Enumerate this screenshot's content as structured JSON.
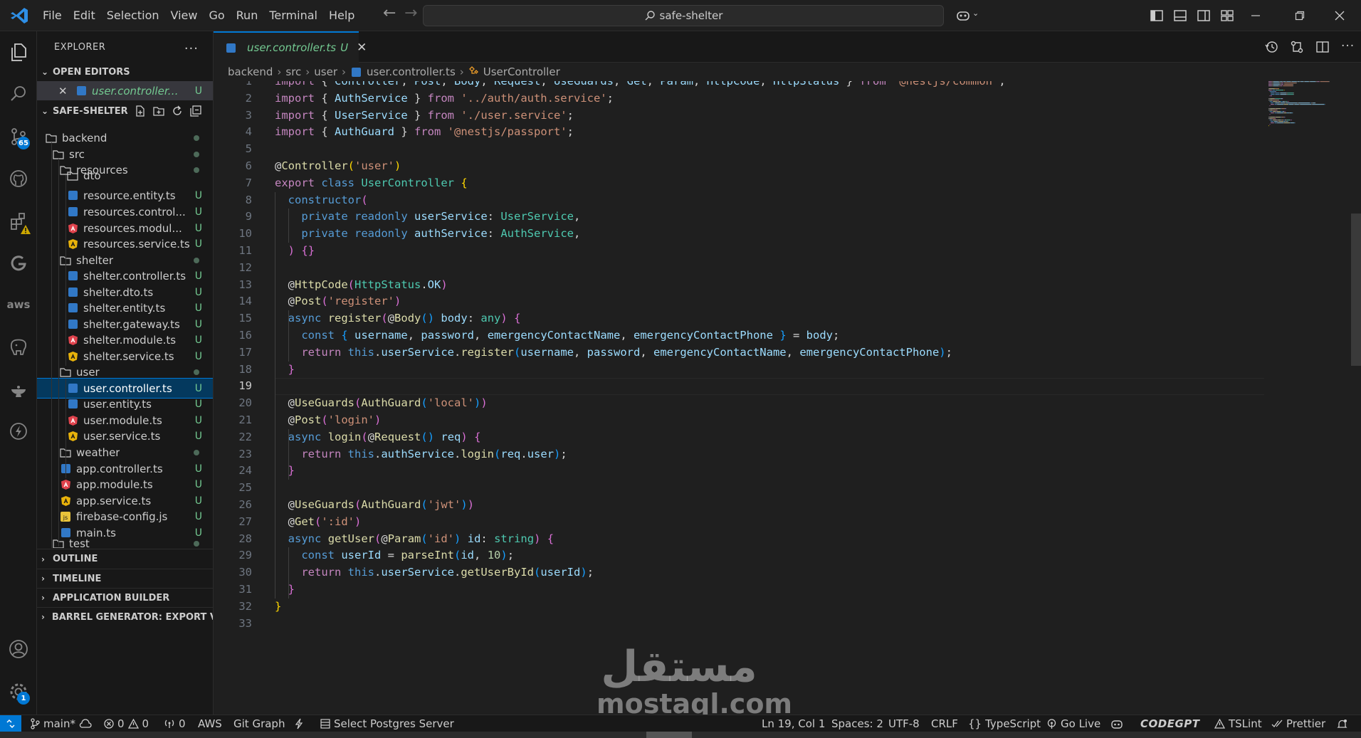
{
  "titlebar": {
    "menu": [
      "File",
      "Edit",
      "Selection",
      "View",
      "Go",
      "Run",
      "Terminal",
      "Help"
    ],
    "search_text": "safe-shelter"
  },
  "activity": {
    "source_control_badge": "65",
    "settings_badge": "1",
    "aws_label": "aws"
  },
  "sidebar": {
    "title": "EXPLORER",
    "more": "···",
    "open_editors_title": "OPEN EDITORS",
    "open_editor": {
      "name": "user.controller.ts...",
      "status": "U"
    },
    "project_title": "SAFE-SHELTER",
    "tree": [
      {
        "label": "backend",
        "kind": "folder",
        "level": 0,
        "status": "dot"
      },
      {
        "label": "src",
        "kind": "folder",
        "level": 1,
        "status": "dot"
      },
      {
        "label": "resources",
        "kind": "folder",
        "level": 2,
        "status": "dot"
      },
      {
        "label": "dto",
        "kind": "folder-partial",
        "level": 3,
        "status": ""
      },
      {
        "label": "resource.entity.ts",
        "kind": "ts",
        "level": 3,
        "status": "U"
      },
      {
        "label": "resources.control...",
        "kind": "ts",
        "level": 3,
        "status": "U"
      },
      {
        "label": "resources.modul...",
        "kind": "angular",
        "level": 3,
        "status": "U"
      },
      {
        "label": "resources.service.ts",
        "kind": "angular-yellow",
        "level": 3,
        "status": "U"
      },
      {
        "label": "shelter",
        "kind": "folder",
        "level": 2,
        "status": "dot"
      },
      {
        "label": "shelter.controller.ts",
        "kind": "ts",
        "level": 3,
        "status": "U"
      },
      {
        "label": "shelter.dto.ts",
        "kind": "ts",
        "level": 3,
        "status": "U"
      },
      {
        "label": "shelter.entity.ts",
        "kind": "ts",
        "level": 3,
        "status": "U"
      },
      {
        "label": "shelter.gateway.ts",
        "kind": "ts",
        "level": 3,
        "status": "U"
      },
      {
        "label": "shelter.module.ts",
        "kind": "angular",
        "level": 3,
        "status": "U"
      },
      {
        "label": "shelter.service.ts",
        "kind": "angular-yellow",
        "level": 3,
        "status": "U"
      },
      {
        "label": "user",
        "kind": "folder",
        "level": 2,
        "status": "dot"
      },
      {
        "label": "user.controller.ts",
        "kind": "ts",
        "level": 3,
        "status": "U",
        "selected": true
      },
      {
        "label": "user.entity.ts",
        "kind": "ts",
        "level": 3,
        "status": "U"
      },
      {
        "label": "user.module.ts",
        "kind": "angular",
        "level": 3,
        "status": "U"
      },
      {
        "label": "user.service.ts",
        "kind": "angular-yellow",
        "level": 3,
        "status": "U"
      },
      {
        "label": "weather",
        "kind": "folder",
        "level": 2,
        "status": "dot"
      },
      {
        "label": "app.controller.ts",
        "kind": "ts",
        "level": 2,
        "status": "U"
      },
      {
        "label": "app.module.ts",
        "kind": "angular",
        "level": 2,
        "status": "U"
      },
      {
        "label": "app.service.ts",
        "kind": "angular-yellow",
        "level": 2,
        "status": "U"
      },
      {
        "label": "firebase-config.js",
        "kind": "js",
        "level": 2,
        "status": "U"
      },
      {
        "label": "main.ts",
        "kind": "ts",
        "level": 2,
        "status": "U"
      },
      {
        "label": "test",
        "kind": "folder-partial",
        "level": 1,
        "status": "dot"
      }
    ],
    "bottom_sections": [
      "OUTLINE",
      "TIMELINE",
      "APPLICATION BUILDER",
      "BARREL GENERATOR: EXPORT V..."
    ]
  },
  "tab": {
    "name": "user.controller.ts",
    "status": "U",
    "close": "✕"
  },
  "breadcrumbs": [
    "backend",
    "src",
    "user",
    "user.controller.ts",
    "UserController"
  ],
  "editor": {
    "current_line": 19,
    "lines": [
      [
        [
          "import",
          "t-ctl"
        ],
        [
          " { ",
          "t-p"
        ],
        [
          "Controller",
          "t-var"
        ],
        [
          ", ",
          "t-p"
        ],
        [
          "Post",
          "t-var"
        ],
        [
          ", ",
          "t-p"
        ],
        [
          "Body",
          "t-var"
        ],
        [
          ", ",
          "t-p"
        ],
        [
          "Request",
          "t-var"
        ],
        [
          ", ",
          "t-p"
        ],
        [
          "UseGuards",
          "t-var"
        ],
        [
          ", ",
          "t-p"
        ],
        [
          "Get",
          "t-var"
        ],
        [
          ", ",
          "t-p"
        ],
        [
          "Param",
          "t-var"
        ],
        [
          ", ",
          "t-p"
        ],
        [
          "HttpCode",
          "t-var"
        ],
        [
          ", ",
          "t-p"
        ],
        [
          "HttpStatus",
          "t-var"
        ],
        [
          " } ",
          "t-p"
        ],
        [
          "from",
          "t-ctl"
        ],
        [
          " ",
          "t-p"
        ],
        [
          "'@nestjs/common'",
          "t-str"
        ],
        [
          ";",
          "t-p"
        ]
      ],
      [
        [
          "import",
          "t-ctl"
        ],
        [
          " { ",
          "t-p"
        ],
        [
          "AuthService",
          "t-var"
        ],
        [
          " } ",
          "t-p"
        ],
        [
          "from",
          "t-ctl"
        ],
        [
          " ",
          "t-p"
        ],
        [
          "'../auth/auth.service'",
          "t-str"
        ],
        [
          ";",
          "t-p"
        ]
      ],
      [
        [
          "import",
          "t-ctl"
        ],
        [
          " { ",
          "t-p"
        ],
        [
          "UserService",
          "t-var"
        ],
        [
          " } ",
          "t-p"
        ],
        [
          "from",
          "t-ctl"
        ],
        [
          " ",
          "t-p"
        ],
        [
          "'./user.service'",
          "t-str"
        ],
        [
          ";",
          "t-p"
        ]
      ],
      [
        [
          "import",
          "t-ctl"
        ],
        [
          " { ",
          "t-p"
        ],
        [
          "AuthGuard",
          "t-var"
        ],
        [
          " } ",
          "t-p"
        ],
        [
          "from",
          "t-ctl"
        ],
        [
          " ",
          "t-p"
        ],
        [
          "'@nestjs/passport'",
          "t-str"
        ],
        [
          ";",
          "t-p"
        ]
      ],
      [],
      [
        [
          "@",
          "t-p"
        ],
        [
          "Controller",
          "t-fn"
        ],
        [
          "(",
          "t-b1"
        ],
        [
          "'user'",
          "t-str"
        ],
        [
          ")",
          "t-b1"
        ]
      ],
      [
        [
          "export",
          "t-ctl"
        ],
        [
          " ",
          "t-p"
        ],
        [
          "class",
          "t-kw"
        ],
        [
          " ",
          "t-p"
        ],
        [
          "UserController",
          "t-ty"
        ],
        [
          " ",
          "t-p"
        ],
        [
          "{",
          "t-b1"
        ]
      ],
      [
        [
          "  ",
          "t-p"
        ],
        [
          "constructor",
          "t-kw"
        ],
        [
          "(",
          "t-b2"
        ]
      ],
      [
        [
          "    ",
          "t-p"
        ],
        [
          "private",
          "t-kw"
        ],
        [
          " ",
          "t-p"
        ],
        [
          "readonly",
          "t-kw"
        ],
        [
          " ",
          "t-p"
        ],
        [
          "userService",
          "t-var"
        ],
        [
          ": ",
          "t-p"
        ],
        [
          "UserService",
          "t-ty"
        ],
        [
          ",",
          "t-p"
        ]
      ],
      [
        [
          "    ",
          "t-p"
        ],
        [
          "private",
          "t-kw"
        ],
        [
          " ",
          "t-p"
        ],
        [
          "readonly",
          "t-kw"
        ],
        [
          " ",
          "t-p"
        ],
        [
          "authService",
          "t-var"
        ],
        [
          ": ",
          "t-p"
        ],
        [
          "AuthService",
          "t-ty"
        ],
        [
          ",",
          "t-p"
        ]
      ],
      [
        [
          "  ",
          "t-p"
        ],
        [
          ")",
          "t-b2"
        ],
        [
          " ",
          "t-p"
        ],
        [
          "{}",
          "t-b2"
        ]
      ],
      [],
      [
        [
          "  @",
          "t-p"
        ],
        [
          "HttpCode",
          "t-fn"
        ],
        [
          "(",
          "t-b2"
        ],
        [
          "HttpStatus",
          "t-ty"
        ],
        [
          ".",
          "t-p"
        ],
        [
          "OK",
          "t-var"
        ],
        [
          ")",
          "t-b2"
        ]
      ],
      [
        [
          "  @",
          "t-p"
        ],
        [
          "Post",
          "t-fn"
        ],
        [
          "(",
          "t-b2"
        ],
        [
          "'register'",
          "t-str"
        ],
        [
          ")",
          "t-b2"
        ]
      ],
      [
        [
          "  ",
          "t-p"
        ],
        [
          "async",
          "t-kw"
        ],
        [
          " ",
          "t-p"
        ],
        [
          "register",
          "t-fn"
        ],
        [
          "(",
          "t-b2"
        ],
        [
          "@",
          "t-p"
        ],
        [
          "Body",
          "t-fn"
        ],
        [
          "()",
          "t-b3"
        ],
        [
          " ",
          "t-p"
        ],
        [
          "body",
          "t-var"
        ],
        [
          ": ",
          "t-p"
        ],
        [
          "any",
          "t-ty"
        ],
        [
          ")",
          "t-b2"
        ],
        [
          " ",
          "t-p"
        ],
        [
          "{",
          "t-b2"
        ]
      ],
      [
        [
          "    ",
          "t-p"
        ],
        [
          "const",
          "t-kw"
        ],
        [
          " ",
          "t-p"
        ],
        [
          "{",
          "t-b3"
        ],
        [
          " ",
          "t-p"
        ],
        [
          "username",
          "t-var"
        ],
        [
          ", ",
          "t-p"
        ],
        [
          "password",
          "t-var"
        ],
        [
          ", ",
          "t-p"
        ],
        [
          "emergencyContactName",
          "t-var"
        ],
        [
          ", ",
          "t-p"
        ],
        [
          "emergencyContactPhone",
          "t-var"
        ],
        [
          " ",
          "t-p"
        ],
        [
          "}",
          "t-b3"
        ],
        [
          " = ",
          "t-p"
        ],
        [
          "body",
          "t-var"
        ],
        [
          ";",
          "t-p"
        ]
      ],
      [
        [
          "    ",
          "t-p"
        ],
        [
          "return",
          "t-ctl"
        ],
        [
          " ",
          "t-p"
        ],
        [
          "this",
          "t-kw"
        ],
        [
          ".",
          "t-p"
        ],
        [
          "userService",
          "t-var"
        ],
        [
          ".",
          "t-p"
        ],
        [
          "register",
          "t-fn"
        ],
        [
          "(",
          "t-b3"
        ],
        [
          "username",
          "t-var"
        ],
        [
          ", ",
          "t-p"
        ],
        [
          "password",
          "t-var"
        ],
        [
          ", ",
          "t-p"
        ],
        [
          "emergencyContactName",
          "t-var"
        ],
        [
          ", ",
          "t-p"
        ],
        [
          "emergencyContactPhone",
          "t-var"
        ],
        [
          ")",
          "t-b3"
        ],
        [
          ";",
          "t-p"
        ]
      ],
      [
        [
          "  ",
          "t-p"
        ],
        [
          "}",
          "t-b2"
        ]
      ],
      [],
      [
        [
          "  @",
          "t-p"
        ],
        [
          "UseGuards",
          "t-fn"
        ],
        [
          "(",
          "t-b2"
        ],
        [
          "AuthGuard",
          "t-fn"
        ],
        [
          "(",
          "t-b3"
        ],
        [
          "'local'",
          "t-str"
        ],
        [
          ")",
          "t-b3"
        ],
        [
          ")",
          "t-b2"
        ]
      ],
      [
        [
          "  @",
          "t-p"
        ],
        [
          "Post",
          "t-fn"
        ],
        [
          "(",
          "t-b2"
        ],
        [
          "'login'",
          "t-str"
        ],
        [
          ")",
          "t-b2"
        ]
      ],
      [
        [
          "  ",
          "t-p"
        ],
        [
          "async",
          "t-kw"
        ],
        [
          " ",
          "t-p"
        ],
        [
          "login",
          "t-fn"
        ],
        [
          "(",
          "t-b2"
        ],
        [
          "@",
          "t-p"
        ],
        [
          "Request",
          "t-fn"
        ],
        [
          "()",
          "t-b3"
        ],
        [
          " ",
          "t-p"
        ],
        [
          "req",
          "t-var"
        ],
        [
          ")",
          "t-b2"
        ],
        [
          " ",
          "t-p"
        ],
        [
          "{",
          "t-b2"
        ]
      ],
      [
        [
          "    ",
          "t-p"
        ],
        [
          "return",
          "t-ctl"
        ],
        [
          " ",
          "t-p"
        ],
        [
          "this",
          "t-kw"
        ],
        [
          ".",
          "t-p"
        ],
        [
          "authService",
          "t-var"
        ],
        [
          ".",
          "t-p"
        ],
        [
          "login",
          "t-fn"
        ],
        [
          "(",
          "t-b3"
        ],
        [
          "req",
          "t-var"
        ],
        [
          ".",
          "t-p"
        ],
        [
          "user",
          "t-var"
        ],
        [
          ")",
          "t-b3"
        ],
        [
          ";",
          "t-p"
        ]
      ],
      [
        [
          "  ",
          "t-p"
        ],
        [
          "}",
          "t-b2"
        ]
      ],
      [],
      [
        [
          "  @",
          "t-p"
        ],
        [
          "UseGuards",
          "t-fn"
        ],
        [
          "(",
          "t-b2"
        ],
        [
          "AuthGuard",
          "t-fn"
        ],
        [
          "(",
          "t-b3"
        ],
        [
          "'jwt'",
          "t-str"
        ],
        [
          ")",
          "t-b3"
        ],
        [
          ")",
          "t-b2"
        ]
      ],
      [
        [
          "  @",
          "t-p"
        ],
        [
          "Get",
          "t-fn"
        ],
        [
          "(",
          "t-b2"
        ],
        [
          "':id'",
          "t-str"
        ],
        [
          ")",
          "t-b2"
        ]
      ],
      [
        [
          "  ",
          "t-p"
        ],
        [
          "async",
          "t-kw"
        ],
        [
          " ",
          "t-p"
        ],
        [
          "getUser",
          "t-fn"
        ],
        [
          "(",
          "t-b2"
        ],
        [
          "@",
          "t-p"
        ],
        [
          "Param",
          "t-fn"
        ],
        [
          "(",
          "t-b3"
        ],
        [
          "'id'",
          "t-str"
        ],
        [
          ")",
          "t-b3"
        ],
        [
          " ",
          "t-p"
        ],
        [
          "id",
          "t-var"
        ],
        [
          ": ",
          "t-p"
        ],
        [
          "string",
          "t-ty"
        ],
        [
          ")",
          "t-b2"
        ],
        [
          " ",
          "t-p"
        ],
        [
          "{",
          "t-b2"
        ]
      ],
      [
        [
          "    ",
          "t-p"
        ],
        [
          "const",
          "t-kw"
        ],
        [
          " ",
          "t-p"
        ],
        [
          "userId",
          "t-var"
        ],
        [
          " = ",
          "t-p"
        ],
        [
          "parseInt",
          "t-fn"
        ],
        [
          "(",
          "t-b3"
        ],
        [
          "id",
          "t-var"
        ],
        [
          ", ",
          "t-p"
        ],
        [
          "10",
          "t-num"
        ],
        [
          ")",
          "t-b3"
        ],
        [
          ";",
          "t-p"
        ]
      ],
      [
        [
          "    ",
          "t-p"
        ],
        [
          "return",
          "t-ctl"
        ],
        [
          " ",
          "t-p"
        ],
        [
          "this",
          "t-kw"
        ],
        [
          ".",
          "t-p"
        ],
        [
          "userService",
          "t-var"
        ],
        [
          ".",
          "t-p"
        ],
        [
          "getUserById",
          "t-fn"
        ],
        [
          "(",
          "t-b3"
        ],
        [
          "userId",
          "t-var"
        ],
        [
          ")",
          "t-b3"
        ],
        [
          ";",
          "t-p"
        ]
      ],
      [
        [
          "  ",
          "t-p"
        ],
        [
          "}",
          "t-b2"
        ]
      ],
      [
        [
          "}",
          "t-b1"
        ]
      ],
      []
    ]
  },
  "statusbar": {
    "branch": "main*",
    "errors": "0",
    "warnings": "0",
    "ports": "0",
    "aws": "AWS",
    "git_graph": "Git Graph",
    "postgres": "Select Postgres Server",
    "position": "Ln 19, Col 1",
    "spaces": "Spaces: 2",
    "encoding": "UTF-8",
    "eol": "CRLF",
    "language": "TypeScript",
    "golive": "Go Live",
    "codegpt": "CODEGPT",
    "tslint": "TSLint",
    "prettier": "Prettier"
  },
  "watermark": {
    "arabic": "مستقل",
    "latin": "mostaql.com"
  }
}
